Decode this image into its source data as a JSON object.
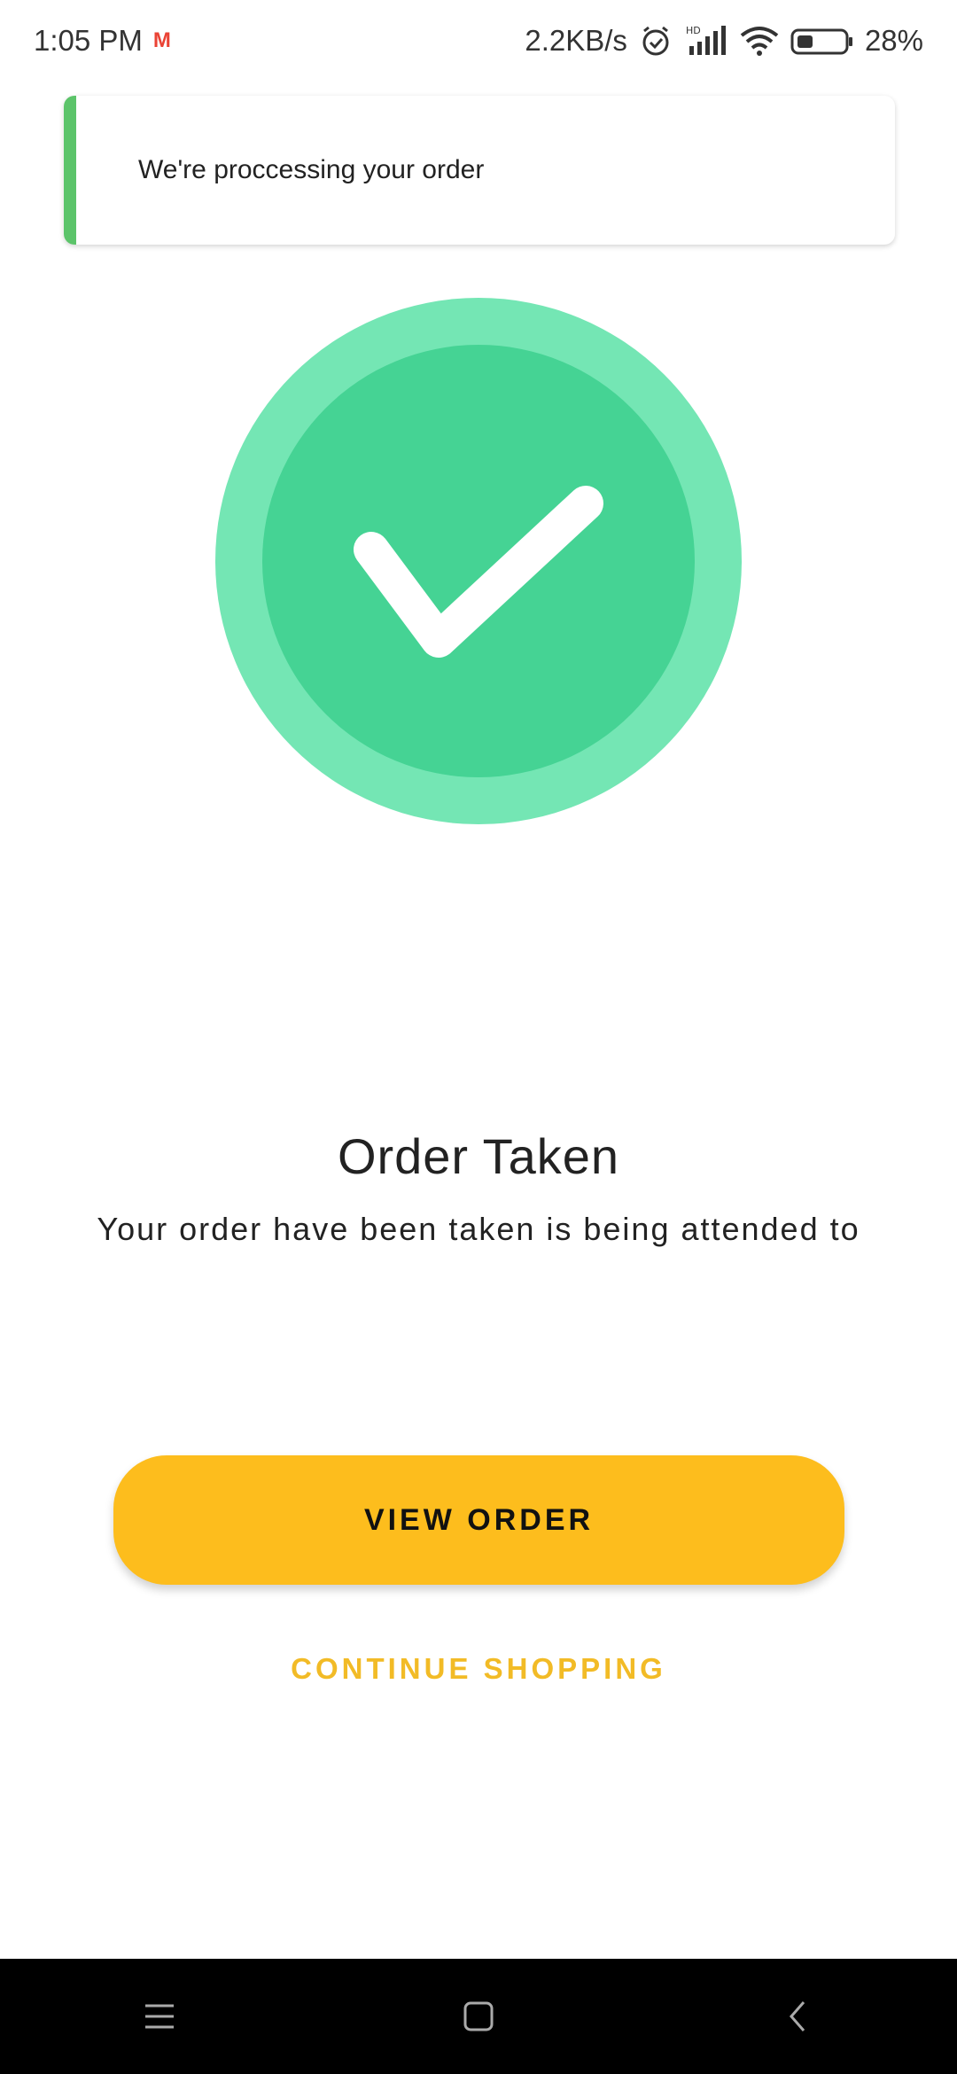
{
  "status_bar": {
    "time": "1:05 PM",
    "network_speed": "2.2KB/s",
    "battery_percent": "28%",
    "icons": [
      "gmail-icon",
      "alarm-icon",
      "hd-signal-icon",
      "wifi-icon",
      "battery-icon"
    ]
  },
  "toast": {
    "message": "We're proccessing your order",
    "accent_color": "#5cc46a"
  },
  "success": {
    "icon": "check-icon",
    "outer_color": "#74e6b4",
    "inner_color": "#45d394"
  },
  "main": {
    "title": "Order Taken",
    "subtitle": "Your order have been taken is being attended to"
  },
  "actions": {
    "view_order_label": "VIEW ORDER",
    "continue_label": "CONTINUE SHOPPING",
    "primary_color": "#fdbd1d"
  },
  "nav_bar": {
    "buttons": [
      "menu-icon",
      "home-icon",
      "back-icon"
    ]
  }
}
